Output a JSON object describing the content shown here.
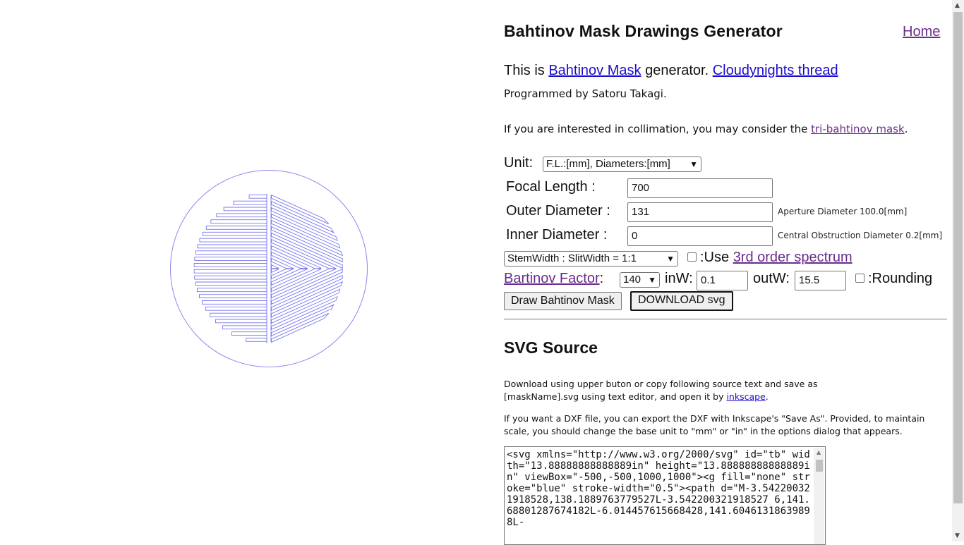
{
  "header": {
    "title": "Bahtinov Mask Drawings Generator",
    "home_link": "Home"
  },
  "intro": {
    "prefix": "This is ",
    "bahtinov_link": "Bahtinov Mask",
    "middle": " generator. ",
    "cloudynights_link": "Cloudynights thread",
    "programmed_by": "Programmed by Satoru Takagi.",
    "collimation_prefix": "If you are interested in collimation, you may consider the ",
    "tri_bahtinov_link": "tri-bahtinov mask",
    "collimation_suffix": "."
  },
  "form": {
    "unit_label": "Unit:",
    "unit_selected": "F.L.:[mm], Diameters:[mm]",
    "focal_length_label": "Focal Length :",
    "focal_length_value": "700",
    "outer_diameter_label": "Outer Diameter :",
    "outer_diameter_value": "131",
    "aperture_note": "Aperture Diameter 100.0[mm]",
    "inner_diameter_label": "Inner Diameter :",
    "inner_diameter_value": "0",
    "central_obstruction_note": "Central Obstruction Diameter 0.2[mm]",
    "stem_slit_selected": "StemWidth : SlitWidth = 1:1",
    "use_3rd_label": ":Use ",
    "third_order_link": "3rd order spectrum",
    "bartinov_factor_link": "Bartinov Factor",
    "bartinov_colon": ":",
    "bartinov_factor_selected": "140",
    "inw_label": "inW:",
    "inw_value": "0.1",
    "outw_label": "outW:",
    "outw_value": "15.5",
    "rounding_label": ":Rounding",
    "draw_button": "Draw Bahtinov Mask",
    "download_button": "DOWNLOAD svg"
  },
  "svg_source": {
    "heading": "SVG Source",
    "para1_prefix": "Download using upper buton or copy following source text and save as [maskName].svg using text editor, and open it by ",
    "inkscape_link": "inkscape",
    "para1_suffix": ".",
    "para2": "If you want a DXF file, you can export the DXF with Inkscape's \"Save As\". Provided, to maintain scale, you should change the base unit to \"mm\" or \"in\" in the options dialog that appears.",
    "source_text": "<svg xmlns=\"http://www.w3.org/2000/svg\" id=\"tb\" width=\"13.88888888888889in\" height=\"13.88888888888889in\" viewBox=\"-500,-500,1000,1000\"><g fill=\"none\" stroke=\"blue\" stroke-width=\"0.5\"><path d=\"M-3.542200321918528,138.1889763779527L-3.542200321918527 6,141.68801287674182L-6.014457615668428,141.60461318639898L-"
  },
  "mask_drawing": {
    "stroke_color": "#7777ee",
    "horizontal_slit_count": 24,
    "diagonal_slit_count": 16
  },
  "colors": {
    "link": "#1a0dcc",
    "visited_link": "#6a2c8c"
  }
}
